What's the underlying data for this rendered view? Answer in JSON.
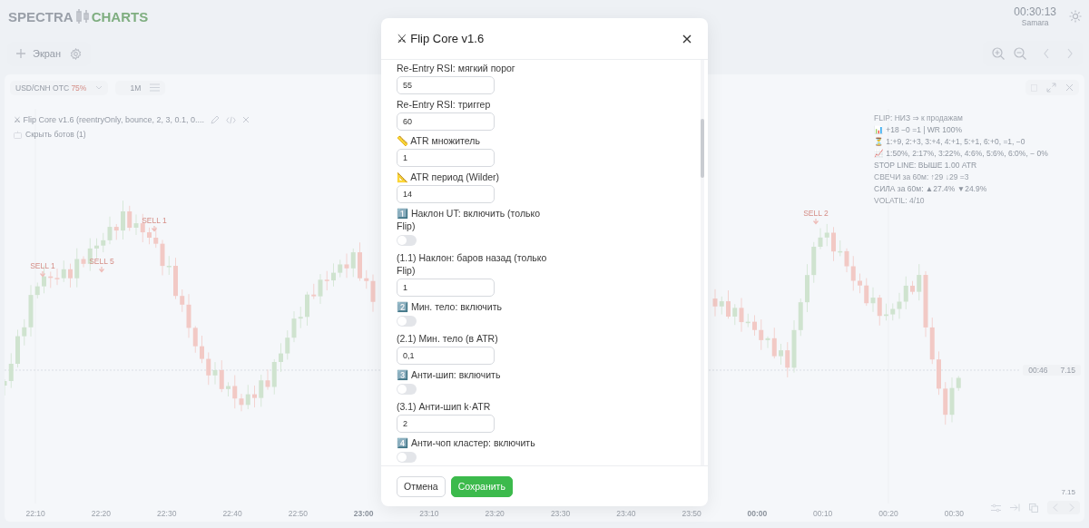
{
  "header": {
    "logo": [
      "SPECTRA",
      "CHARTS"
    ],
    "clock": "00:30:13",
    "timezone": "Samara"
  },
  "toolbar": {
    "add_button": "Экран"
  },
  "chart": {
    "symbol": "USD/CNH OTC",
    "payout": "75%",
    "timeframe": "1M",
    "bot": {
      "title": "⚔ Flip Core v1.6 (reentryOnly, bounce, 2, 3, 0.1, 0....",
      "hide": "Скрыть ботов (1)"
    },
    "info": [
      "FLIP: НИЗ ⇒ к продажам",
      "📊 +18 −0 =1 | WR 100%",
      "⏳ 1:+9, 2:+3, 3:+4, 4:+1, 5:+1, 6:+0, =1, −0",
      "📈 1:50%, 2:17%, 3:22%, 4:6%, 5:6%, 6:0%, − 0%",
      "STOP LINE: ВЫШЕ 1.00 ATR",
      "СВЕЧИ за 60м: ↑29 ↓29 =3",
      "СИЛА за 60м: ▲27.4% ▼24.9%",
      "VOLATIL: 4/10"
    ],
    "signals": [
      {
        "label": "SELL 1"
      },
      {
        "label": "SELL 5"
      },
      {
        "label": "SELL 1"
      },
      {
        "label": "SELL 2"
      }
    ],
    "price_tag": {
      "countdown": "00:46",
      "price": "7.15"
    },
    "axis_price": "7.15",
    "time_labels": [
      {
        "label": "22:10",
        "bold": false
      },
      {
        "label": "22:20",
        "bold": false
      },
      {
        "label": "22:30",
        "bold": false
      },
      {
        "label": "22:40",
        "bold": false
      },
      {
        "label": "22:50",
        "bold": false
      },
      {
        "label": "23:00",
        "bold": true
      },
      {
        "label": "23:10",
        "bold": false
      },
      {
        "label": "23:20",
        "bold": false
      },
      {
        "label": "23:30",
        "bold": false
      },
      {
        "label": "23:40",
        "bold": false
      },
      {
        "label": "23:50",
        "bold": false
      },
      {
        "label": "00:00",
        "bold": true
      },
      {
        "label": "00:10",
        "bold": false
      },
      {
        "label": "00:20",
        "bold": false
      },
      {
        "label": "00:30",
        "bold": false
      }
    ]
  },
  "dialog": {
    "title": "⚔ Flip Core v1.6",
    "fields": [
      {
        "kind": "number",
        "label": "Re-Entry RSI: мягкий порог",
        "value": "55"
      },
      {
        "kind": "number",
        "label": "Re-Entry RSI: триггер",
        "value": "60"
      },
      {
        "kind": "number",
        "label": "📏 ATR множитель",
        "value": "1"
      },
      {
        "kind": "number",
        "label": "📐 ATR период (Wilder)",
        "value": "14"
      },
      {
        "kind": "toggle",
        "label": "1️⃣ Наклон UT: включить (только Flip)",
        "on": false
      },
      {
        "kind": "number",
        "label": "(1.1) Наклон: баров назад (только Flip)",
        "value": "1"
      },
      {
        "kind": "toggle",
        "label": "2️⃣ Мин. тело: включить",
        "on": false
      },
      {
        "kind": "number",
        "label": "(2.1) Мин. тело (в ATR)",
        "value": "0,1"
      },
      {
        "kind": "toggle",
        "label": "3️⃣ Анти-шип: включить",
        "on": false
      },
      {
        "kind": "number",
        "label": "(3.1) Анти-шип k·ATR",
        "value": "2"
      },
      {
        "kind": "toggle",
        "label": "4️⃣ Анти-чоп кластер: включить",
        "on": false
      }
    ],
    "buttons": [
      {
        "label": "Отмена",
        "kind": "secondary"
      },
      {
        "label": "Сохранить",
        "kind": "primary"
      }
    ]
  }
}
